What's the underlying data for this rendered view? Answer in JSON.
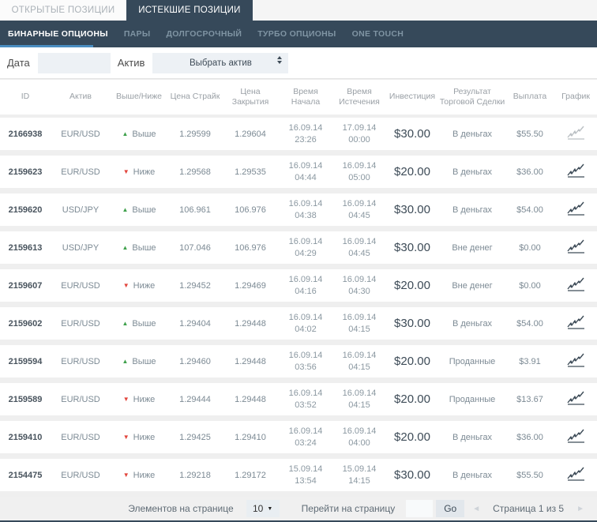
{
  "tabs": {
    "open": "ОТКРЫТЫЕ ПОЗИЦИИ",
    "expired": "ИСТЕКШИЕ ПОЗИЦИИ"
  },
  "nav": {
    "items": [
      {
        "label": "БИНАРНЫЕ ОПЦИОНЫ",
        "active": true
      },
      {
        "label": "ПАРЫ",
        "active": false
      },
      {
        "label": "ДОЛГОСРОЧНЫЙ",
        "active": false
      },
      {
        "label": "ТУРБО ОПЦИОНЫ",
        "active": false
      },
      {
        "label": "ONE TOUCH",
        "active": false
      }
    ]
  },
  "filters": {
    "date_label": "Дата",
    "date_value": "",
    "asset_label": "Актив",
    "asset_selected": "Выбрать актив"
  },
  "table": {
    "headers": [
      "ID",
      "Актив",
      "Выше/Ниже",
      "Цена Страйк",
      "Цена Закрытия",
      "Время Начала",
      "Время Истечения",
      "Инвестиция",
      "Результат Торговой Сделки",
      "Выплата",
      "График"
    ],
    "rows": [
      {
        "id": "2166938",
        "asset": "EUR/USD",
        "direction": "Выше",
        "direction_up": true,
        "strike": "1.29599",
        "close": "1.29604",
        "start_date": "16.09.14",
        "start_time": "23:26",
        "end_date": "17.09.14",
        "end_time": "00:00",
        "investment": "$30.00",
        "result": "В деньгах",
        "payout": "$55.50",
        "chart_muted": true
      },
      {
        "id": "2159623",
        "asset": "EUR/USD",
        "direction": "Ниже",
        "direction_up": false,
        "strike": "1.29568",
        "close": "1.29535",
        "start_date": "16.09.14",
        "start_time": "04:44",
        "end_date": "16.09.14",
        "end_time": "05:00",
        "investment": "$20.00",
        "result": "В деньгах",
        "payout": "$36.00",
        "chart_muted": false
      },
      {
        "id": "2159620",
        "asset": "USD/JPY",
        "direction": "Выше",
        "direction_up": true,
        "strike": "106.961",
        "close": "106.976",
        "start_date": "16.09.14",
        "start_time": "04:38",
        "end_date": "16.09.14",
        "end_time": "04:45",
        "investment": "$30.00",
        "result": "В деньгах",
        "payout": "$54.00",
        "chart_muted": false
      },
      {
        "id": "2159613",
        "asset": "USD/JPY",
        "direction": "Выше",
        "direction_up": true,
        "strike": "107.046",
        "close": "106.976",
        "start_date": "16.09.14",
        "start_time": "04:29",
        "end_date": "16.09.14",
        "end_time": "04:45",
        "investment": "$30.00",
        "result": "Вне денег",
        "payout": "$0.00",
        "chart_muted": false
      },
      {
        "id": "2159607",
        "asset": "EUR/USD",
        "direction": "Ниже",
        "direction_up": false,
        "strike": "1.29452",
        "close": "1.29469",
        "start_date": "16.09.14",
        "start_time": "04:16",
        "end_date": "16.09.14",
        "end_time": "04:30",
        "investment": "$20.00",
        "result": "Вне денег",
        "payout": "$0.00",
        "chart_muted": false
      },
      {
        "id": "2159602",
        "asset": "EUR/USD",
        "direction": "Выше",
        "direction_up": true,
        "strike": "1.29404",
        "close": "1.29448",
        "start_date": "16.09.14",
        "start_time": "04:02",
        "end_date": "16.09.14",
        "end_time": "04:15",
        "investment": "$30.00",
        "result": "В деньгах",
        "payout": "$54.00",
        "chart_muted": false
      },
      {
        "id": "2159594",
        "asset": "EUR/USD",
        "direction": "Выше",
        "direction_up": true,
        "strike": "1.29460",
        "close": "1.29448",
        "start_date": "16.09.14",
        "start_time": "03:56",
        "end_date": "16.09.14",
        "end_time": "04:15",
        "investment": "$20.00",
        "result": "Проданные",
        "payout": "$3.91",
        "chart_muted": false
      },
      {
        "id": "2159589",
        "asset": "EUR/USD",
        "direction": "Ниже",
        "direction_up": false,
        "strike": "1.29444",
        "close": "1.29448",
        "start_date": "16.09.14",
        "start_time": "03:52",
        "end_date": "16.09.14",
        "end_time": "04:15",
        "investment": "$20.00",
        "result": "Проданные",
        "payout": "$13.67",
        "chart_muted": false
      },
      {
        "id": "2159410",
        "asset": "EUR/USD",
        "direction": "Ниже",
        "direction_up": false,
        "strike": "1.29425",
        "close": "1.29410",
        "start_date": "16.09.14",
        "start_time": "03:24",
        "end_date": "16.09.14",
        "end_time": "04:00",
        "investment": "$20.00",
        "result": "В деньгах",
        "payout": "$36.00",
        "chart_muted": false
      },
      {
        "id": "2154475",
        "asset": "EUR/USD",
        "direction": "Ниже",
        "direction_up": false,
        "strike": "1.29218",
        "close": "1.29172",
        "start_date": "15.09.14",
        "start_time": "13:54",
        "end_date": "15.09.14",
        "end_time": "14:15",
        "investment": "$30.00",
        "result": "В деньгах",
        "payout": "$55.50",
        "chart_muted": false
      }
    ]
  },
  "footer": {
    "items_per_page_label": "Элементов на странице",
    "items_per_page_value": "10",
    "goto_label": "Перейти на страницу",
    "goto_value": "",
    "go_button": "Go",
    "page_status": "Страница 1 из 5",
    "prev_arrow": "◄",
    "next_arrow": "►"
  },
  "colors": {
    "dark_slate": "#36495a",
    "accent_blue": "#4a8dc0",
    "up_green": "#3fa14c",
    "down_red": "#e2453c",
    "row_bg": "#ffffff",
    "gap_bg": "#efefef"
  }
}
